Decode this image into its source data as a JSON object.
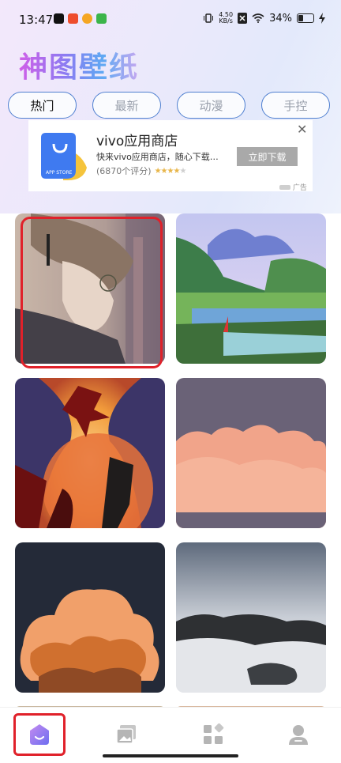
{
  "status_bar": {
    "time": "13:47",
    "net_speed_value": "4.50",
    "net_speed_unit": "KB/s",
    "battery_percent": "34%",
    "battery_level": 0.34
  },
  "app": {
    "title": "神图壁纸"
  },
  "tabs": [
    {
      "label": "热门",
      "active": true
    },
    {
      "label": "最新",
      "active": false
    },
    {
      "label": "动漫",
      "active": false
    },
    {
      "label": "手控",
      "active": false
    }
  ],
  "ad": {
    "title": "vivo应用商店",
    "description": "快来vivo应用商店，随心下载…",
    "rating_count": "(6870个评分)",
    "rating_stars": 4,
    "button_label": "立即下载",
    "close_symbol": "✕",
    "ad_label": "广告",
    "icon_caption": "APP STORE"
  },
  "wallpapers": [
    {
      "name": "anime-girl-glasses"
    },
    {
      "name": "mountain-lake-landscape"
    },
    {
      "name": "silhouette-fantasy-art"
    },
    {
      "name": "orange-cloud"
    },
    {
      "name": "night-cloud"
    },
    {
      "name": "foggy-island"
    }
  ],
  "bottom_nav": [
    {
      "icon": "home-icon",
      "active": true
    },
    {
      "icon": "gallery-icon",
      "active": false
    },
    {
      "icon": "category-icon",
      "active": false
    },
    {
      "icon": "profile-icon",
      "active": false
    }
  ],
  "colors": {
    "tab_border": "#4f7fd0",
    "highlight": "#e0212a",
    "nav_active": "#7a6cf0"
  }
}
